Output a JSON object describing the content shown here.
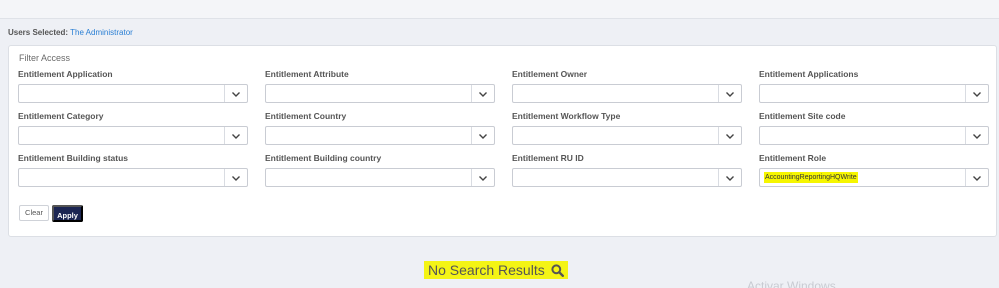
{
  "users_selected": {
    "label": "Users Selected:",
    "value": "The Administrator"
  },
  "filter": {
    "title": "Filter Access",
    "fields": [
      {
        "label": "Entitlement Application",
        "value": ""
      },
      {
        "label": "Entitlement Attribute",
        "value": ""
      },
      {
        "label": "Entitlement Owner",
        "value": ""
      },
      {
        "label": "Entitlement Applications",
        "value": ""
      },
      {
        "label": "Entitlement Category",
        "value": ""
      },
      {
        "label": "Entitlement Country",
        "value": ""
      },
      {
        "label": "Entitlement Workflow Type",
        "value": ""
      },
      {
        "label": "Entitlement Site code",
        "value": ""
      },
      {
        "label": "Entitlement Building status",
        "value": ""
      },
      {
        "label": "Entitlement Building country",
        "value": ""
      },
      {
        "label": "Entitlement RU ID",
        "value": ""
      },
      {
        "label": "Entitlement Role",
        "value": "AccountingReportingHQWrite"
      }
    ],
    "clear_label": "Clear",
    "apply_label": "Apply"
  },
  "results": {
    "message": "No Search Results",
    "icon": "search-icon"
  },
  "watermark": "Activar Windows",
  "colors": {
    "accent": "#2a7fd4",
    "apply_button": "#1b2552",
    "highlight": "#f4f415"
  }
}
